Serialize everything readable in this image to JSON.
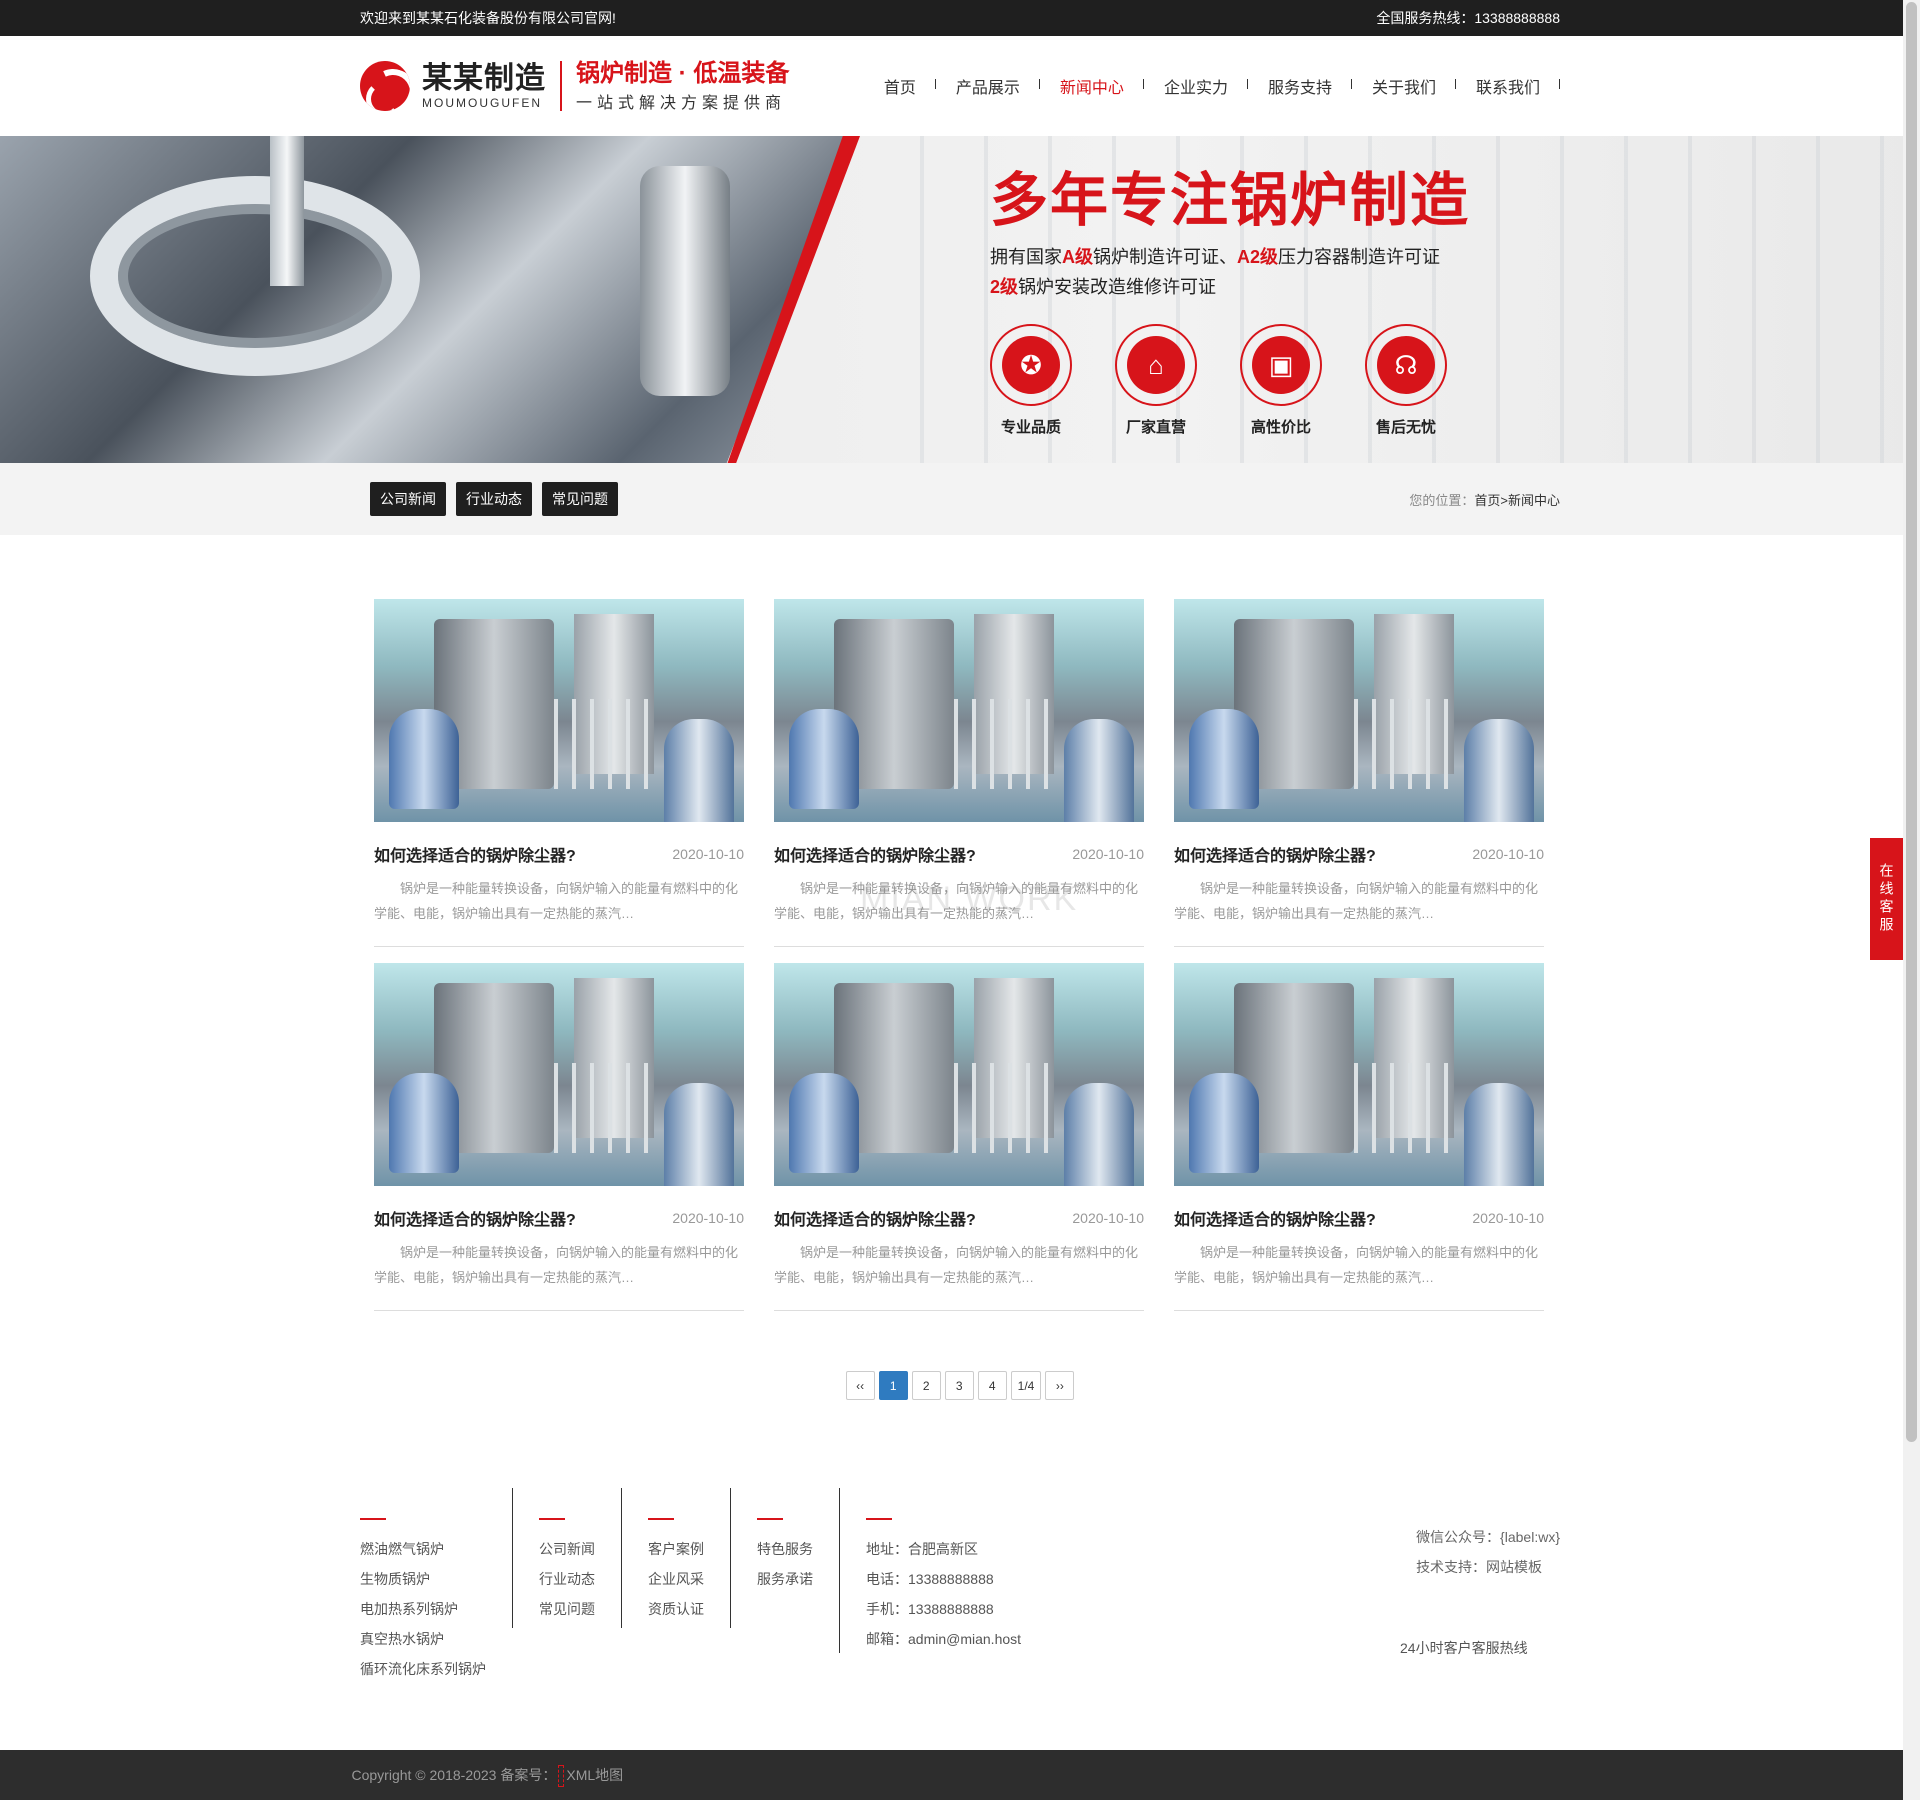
{
  "topbar": {
    "welcome": "欢迎来到某某石化装备股份有限公司官网!",
    "hotline": "全国服务热线：13388888888"
  },
  "logo": {
    "cn": "某某制造",
    "en": "MOUMOUGUFEN",
    "slogan_main": "锅炉制造 · 低温装备",
    "slogan_sub": "一站式解决方案提供商"
  },
  "nav": [
    {
      "label": "首页"
    },
    {
      "label": "产品展示"
    },
    {
      "label": "新闻中心",
      "active": true
    },
    {
      "label": "企业实力"
    },
    {
      "label": "服务支持"
    },
    {
      "label": "关于我们"
    },
    {
      "label": "联系我们"
    }
  ],
  "banner": {
    "title": "多年专注锅炉制造",
    "line1": {
      "a": "拥有国家",
      "b": "A级",
      "c": "锅炉制造许可证、",
      "d": "A2级",
      "e": "压力容器制造许可证"
    },
    "line2": {
      "a": "2级",
      "b": "锅炉安装改造维修许可证"
    },
    "features": [
      {
        "icon": "award-icon",
        "glyph": "✪",
        "label": "专业品质"
      },
      {
        "icon": "store-icon",
        "glyph": "⌂",
        "label": "厂家直营"
      },
      {
        "icon": "wallet-icon",
        "glyph": "▣",
        "label": "高性价比"
      },
      {
        "icon": "headset-icon",
        "glyph": "☊",
        "label": "售后无忧"
      }
    ]
  },
  "subnav": {
    "categories": [
      {
        "label": "公司新闻"
      },
      {
        "label": "行业动态"
      },
      {
        "label": "常见问题"
      }
    ],
    "breadcrumb": {
      "prefix": "您的位置：",
      "home": "首页",
      "sep": ">",
      "current": "新闻中心"
    }
  },
  "news": [
    {
      "title": "如何选择适合的锅炉除尘器?",
      "date": "2020-10-10",
      "desc": "锅炉是一种能量转换设备，向锅炉输入的能量有燃料中的化学能、电能，锅炉输出具有一定热能的蒸汽…"
    },
    {
      "title": "如何选择适合的锅炉除尘器?",
      "date": "2020-10-10",
      "desc": "锅炉是一种能量转换设备，向锅炉输入的能量有燃料中的化学能、电能，锅炉输出具有一定热能的蒸汽…"
    },
    {
      "title": "如何选择适合的锅炉除尘器?",
      "date": "2020-10-10",
      "desc": "锅炉是一种能量转换设备，向锅炉输入的能量有燃料中的化学能、电能，锅炉输出具有一定热能的蒸汽…"
    },
    {
      "title": "如何选择适合的锅炉除尘器?",
      "date": "2020-10-10",
      "desc": "锅炉是一种能量转换设备，向锅炉输入的能量有燃料中的化学能、电能，锅炉输出具有一定热能的蒸汽…"
    },
    {
      "title": "如何选择适合的锅炉除尘器?",
      "date": "2020-10-10",
      "desc": "锅炉是一种能量转换设备，向锅炉输入的能量有燃料中的化学能、电能，锅炉输出具有一定热能的蒸汽…"
    },
    {
      "title": "如何选择适合的锅炉除尘器?",
      "date": "2020-10-10",
      "desc": "锅炉是一种能量转换设备，向锅炉输入的能量有燃料中的化学能、电能，锅炉输出具有一定热能的蒸汽…"
    }
  ],
  "pager": {
    "prev": "‹‹",
    "pages": [
      "1",
      "2",
      "3",
      "4"
    ],
    "active": "1",
    "info": "1/4",
    "next": "››"
  },
  "footer": {
    "col1": [
      "燃油燃气锅炉",
      "生物质锅炉",
      "电加热系列锅炉",
      "真空热水锅炉",
      "循环流化床系列锅炉"
    ],
    "col2": [
      "公司新闻",
      "行业动态",
      "常见问题"
    ],
    "col3": [
      "客户案例",
      "企业风采",
      "资质认证"
    ],
    "col4": [
      "特色服务",
      "服务承诺"
    ],
    "contact": [
      "地址：合肥高新区",
      "电话：13388888888",
      "手机：13388888888",
      "邮箱：admin@mian.host"
    ],
    "wechat": "微信公众号：{label:wx}",
    "support": "技术支持：网站模板",
    "hotline_label": "24小时客户客服热线"
  },
  "copyright": {
    "text": "Copyright © 2018-2023 备案号：",
    "sitemap": "XML地图"
  },
  "side_service": "在线客服",
  "watermark": "MIAN.WORK",
  "colors": {
    "brand": "#d7141a",
    "dark": "#1f1f1f",
    "pager_active": "#2f7bc0"
  }
}
